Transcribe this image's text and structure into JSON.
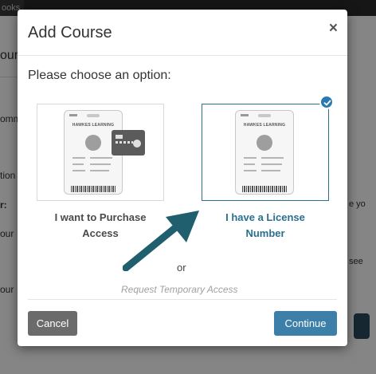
{
  "background": {
    "tab_fragment": "ooks",
    "fragments": [
      "ourse",
      "omm",
      "tion",
      "r:",
      "our",
      "our",
      "e yo",
      "see"
    ]
  },
  "modal": {
    "title": "Add Course",
    "close_glyph": "×",
    "prompt": "Please choose an option:",
    "options": [
      {
        "label_line1": "I want to Purchase",
        "label_line2": "Access",
        "selected": false,
        "badge_org": "HAWKES LEARNING"
      },
      {
        "label_line1": "I have a License",
        "label_line2": "Number",
        "selected": true,
        "badge_org": "HAWKES LEARNING"
      }
    ],
    "or_text": "or",
    "temporary_access_link": "Request Temporary Access",
    "buttons": {
      "cancel": "Cancel",
      "continue": "Continue"
    }
  },
  "colors": {
    "accent": "#2a6f8f",
    "continue_button": "#3c7fa8",
    "cancel_button": "#6b6b6b",
    "annotation_arrow": "#1f5f6e"
  },
  "icons": [
    "close-icon",
    "id-badge-icon",
    "credit-card-icon",
    "checkmark-icon",
    "annotation-arrow-icon"
  ]
}
